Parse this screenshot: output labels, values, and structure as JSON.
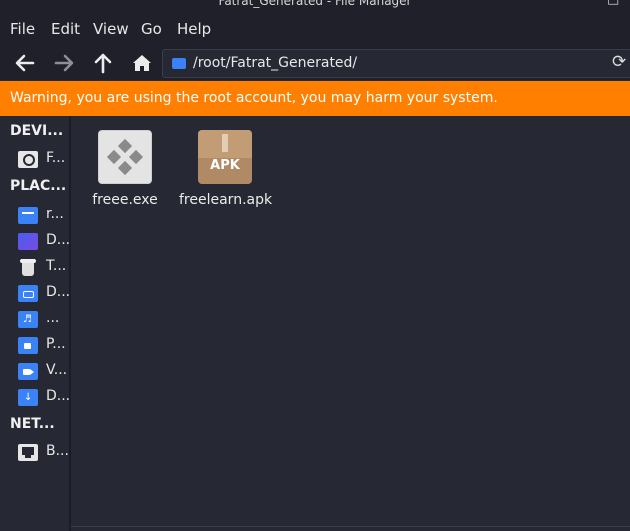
{
  "window": {
    "title": "Fatrat_Generated - File Manager",
    "min_glyph": "–",
    "max_glyph": "□"
  },
  "menu": {
    "items": [
      "File",
      "Edit",
      "View",
      "Go",
      "Help"
    ]
  },
  "toolbar": {
    "path": "/root/Fatrat_Generated/"
  },
  "warning": {
    "text": "Warning, you are using the root account, you may harm your system."
  },
  "sidebar": {
    "devices": {
      "title": "DEVI...",
      "items": [
        {
          "label": "F...",
          "icon": "drive-icon"
        }
      ]
    },
    "places": {
      "title": "PLAC...",
      "items": [
        {
          "label": "r...",
          "icon": "home-folder-icon"
        },
        {
          "label": "D...",
          "icon": "desktop-icon"
        },
        {
          "label": "T...",
          "icon": "trash-icon"
        },
        {
          "label": "D...",
          "icon": "documents-folder-icon"
        },
        {
          "label": "...",
          "icon": "music-folder-icon"
        },
        {
          "label": "P...",
          "icon": "pictures-folder-icon"
        },
        {
          "label": "V...",
          "icon": "videos-folder-icon"
        },
        {
          "label": "D...",
          "icon": "downloads-folder-icon"
        }
      ]
    },
    "network": {
      "title": "NET...",
      "items": [
        {
          "label": "B...",
          "icon": "network-icon"
        }
      ]
    }
  },
  "files": [
    {
      "name": "freee.exe",
      "icon": "exe-file-icon"
    },
    {
      "name": "freelearn.apk",
      "icon": "apk-file-icon",
      "badge": "APK"
    }
  ],
  "colors": {
    "warning_bg": "#ff7f00",
    "accent": "#3b82f6"
  }
}
